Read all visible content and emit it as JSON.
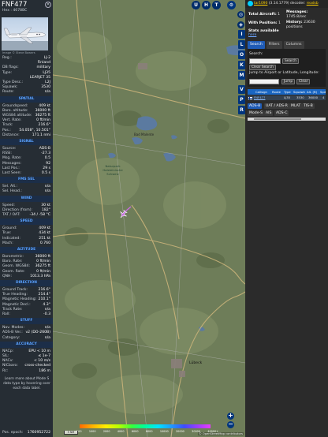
{
  "aircraft": {
    "callsign": "FNF477",
    "hex_line": "Hex : 4678BC",
    "close_glyph": "×",
    "photo_credit": "Image © Steve Bowers"
  },
  "details": [
    {
      "k": "Reg.:",
      "v": "LJ-2"
    },
    {
      "k": "",
      "v": "Finland"
    },
    {
      "k": "DB flags:",
      "v": "military"
    },
    {
      "k": "Type:",
      "v": "LJ35"
    },
    {
      "k": "",
      "v": "LEARJET 35"
    },
    {
      "k": "Type Desc.:",
      "v": "L2J"
    },
    {
      "k": "Squawk:",
      "v": "3530"
    },
    {
      "k": "Route:",
      "v": "n/a"
    }
  ],
  "sections": {
    "spatial": "SPATIAL",
    "signal": "SIGNAL",
    "fms": "FMS SEL",
    "wind": "WIND",
    "speed": "SPEED",
    "altitude": "ALTITUDE",
    "direction": "DIRECTION",
    "stuff": "STUFF",
    "accuracy": "ACCURACY"
  },
  "spatial": [
    {
      "k": "Groundspeed:",
      "v": "409 kt"
    },
    {
      "k": "Baro. altitude:",
      "v": "36000 ft"
    },
    {
      "k": "WGS84 altitude:",
      "v": "36275 ft"
    },
    {
      "k": "Vert. Rate:",
      "v": "0 ft/min"
    },
    {
      "k": "Track:",
      "v": "216.6°"
    },
    {
      "k": "Pos.:",
      "v": "54.058°, 10.501°"
    },
    {
      "k": "Distance:",
      "v": "171.1 nmi"
    }
  ],
  "signal": [
    {
      "k": "Source:",
      "v": "ADS-B"
    },
    {
      "k": "RSSI:",
      "v": "-27.3"
    },
    {
      "k": "Msg. Rate:",
      "v": "0.5"
    },
    {
      "k": "Messages:",
      "v": "92"
    },
    {
      "k": "Last Pos.:",
      "v": "29 s"
    },
    {
      "k": "Last Seen:",
      "v": "0.5 s"
    }
  ],
  "fms": [
    {
      "k": "Sel. Alt.:",
      "v": "n/a"
    },
    {
      "k": "Sel. Head.:",
      "v": "n/a"
    }
  ],
  "wind": [
    {
      "k": "Speed:",
      "v": "30 kt"
    },
    {
      "k": "Direction (from):",
      "v": "182°"
    },
    {
      "k": "TAT / OAT:",
      "v": "-34 / -58 °C"
    }
  ],
  "speed": [
    {
      "k": "Ground:",
      "v": "409 kt"
    },
    {
      "k": "True:",
      "v": "434 kt"
    },
    {
      "k": "Indicated:",
      "v": "251 kt"
    },
    {
      "k": "Mach:",
      "v": "0.760"
    }
  ],
  "altitude": [
    {
      "k": "Barometric:",
      "v": "36000 ft"
    },
    {
      "k": "Baro. Rate:",
      "v": "0 ft/min"
    },
    {
      "k": "Geom. WGS84:",
      "v": "36275 ft"
    },
    {
      "k": "Geom. Rate:",
      "v": "0 ft/min"
    },
    {
      "k": "QNH:",
      "v": "1013.3 hPa"
    }
  ],
  "direction": [
    {
      "k": "Ground Track:",
      "v": "216.6°"
    },
    {
      "k": "True Heading:",
      "v": "214.4°"
    },
    {
      "k": "Magnetic Heading:",
      "v": "210.1°"
    },
    {
      "k": "Magnetic Decl.:",
      "v": "4.3°"
    },
    {
      "k": "Track Rate:",
      "v": "n/a"
    },
    {
      "k": "Roll:",
      "v": "-0.3"
    }
  ],
  "stuff": [
    {
      "k": "Nav. Modes:",
      "v": "n/a"
    },
    {
      "k": "ADS-B Ver.:",
      "v": "v2 (DO-260B)"
    },
    {
      "k": "Category:",
      "v": "n/a"
    }
  ],
  "accuracy": [
    {
      "k": "NACp:",
      "v": "EPU < 10 m"
    },
    {
      "k": "SIL:",
      "v": "≤ 1e-7"
    },
    {
      "k": "NACv:",
      "v": "< 10 m/s"
    },
    {
      "k": "NICbaro:",
      "v": "cross-checked"
    },
    {
      "k": "Rc:",
      "v": "186 m"
    }
  ],
  "learn_more": "Learn more about Mode S data type by hovering over each data label.",
  "pos_epoch": {
    "k": "Pos. epoch:",
    "v": "1760952722"
  },
  "map": {
    "top_buttons": [
      "U",
      "H",
      "T"
    ],
    "side_buttons": [
      "I",
      "L",
      "O",
      "K",
      "M",
      "V",
      "P",
      "R"
    ],
    "zoom_in": "+",
    "zoom_out": "−",
    "scale_label": "5 NM",
    "attribution": "© OpenStreetMap contributors",
    "altitude_labels": [
      "500",
      "1000",
      "2000",
      "4000",
      "6000",
      "8000",
      "10000",
      "20000",
      "30000",
      "40000+"
    ],
    "places": {
      "kiel": "Kiel",
      "naturpark": "Naturpark Holsteinische Schweiz",
      "bad_malente": "Bad Malente",
      "lubeck": "Lübeck"
    }
  },
  "status": {
    "version_name": "tar1090",
    "version_text": "(3.14.1779) decoder:",
    "version_link": "readsb",
    "total_label": "Total Aircraft:",
    "total_value": "1",
    "with_pos_label": "With Position:",
    "with_pos_value": "1",
    "messages_label": "Messages:",
    "messages_value": "1745.8/sec",
    "history_label": "History:",
    "history_value": "23630 positions",
    "stats_label": "Stats available",
    "stats_link": "here"
  },
  "tabs": [
    "Search",
    "Filters",
    "Columns"
  ],
  "search": {
    "label": "Search:",
    "button": "Search",
    "clear": "Clear Search",
    "jump_label": "Jump to Airport or Latitude, Longitude:",
    "jump_button": "Jump",
    "jump_clear": "Clear"
  },
  "table": {
    "headers": [
      "Callsign",
      "Route",
      "Type",
      "Squawk",
      "Alt. (ft)",
      "Spd"
    ],
    "rows": [
      {
        "callsign": "FNF477",
        "route": "",
        "type": "LJ35",
        "squawk": "3530",
        "alt": "36000",
        "spd": "4"
      }
    ]
  },
  "sources": [
    {
      "label": "ADS-B",
      "on": true
    },
    {
      "label": "UAT / ADS-R",
      "on": false
    },
    {
      "label": "MLAT",
      "on": false
    },
    {
      "label": "TIS-B",
      "on": false
    },
    {
      "label": "Mode-S",
      "on": false
    },
    {
      "label": "AIS",
      "on": false
    },
    {
      "label": "ADS-C",
      "on": false
    }
  ],
  "colors": {
    "accent": "#1f5bb5",
    "section_text": "#5aa2ff",
    "plane": "#c86be0"
  }
}
